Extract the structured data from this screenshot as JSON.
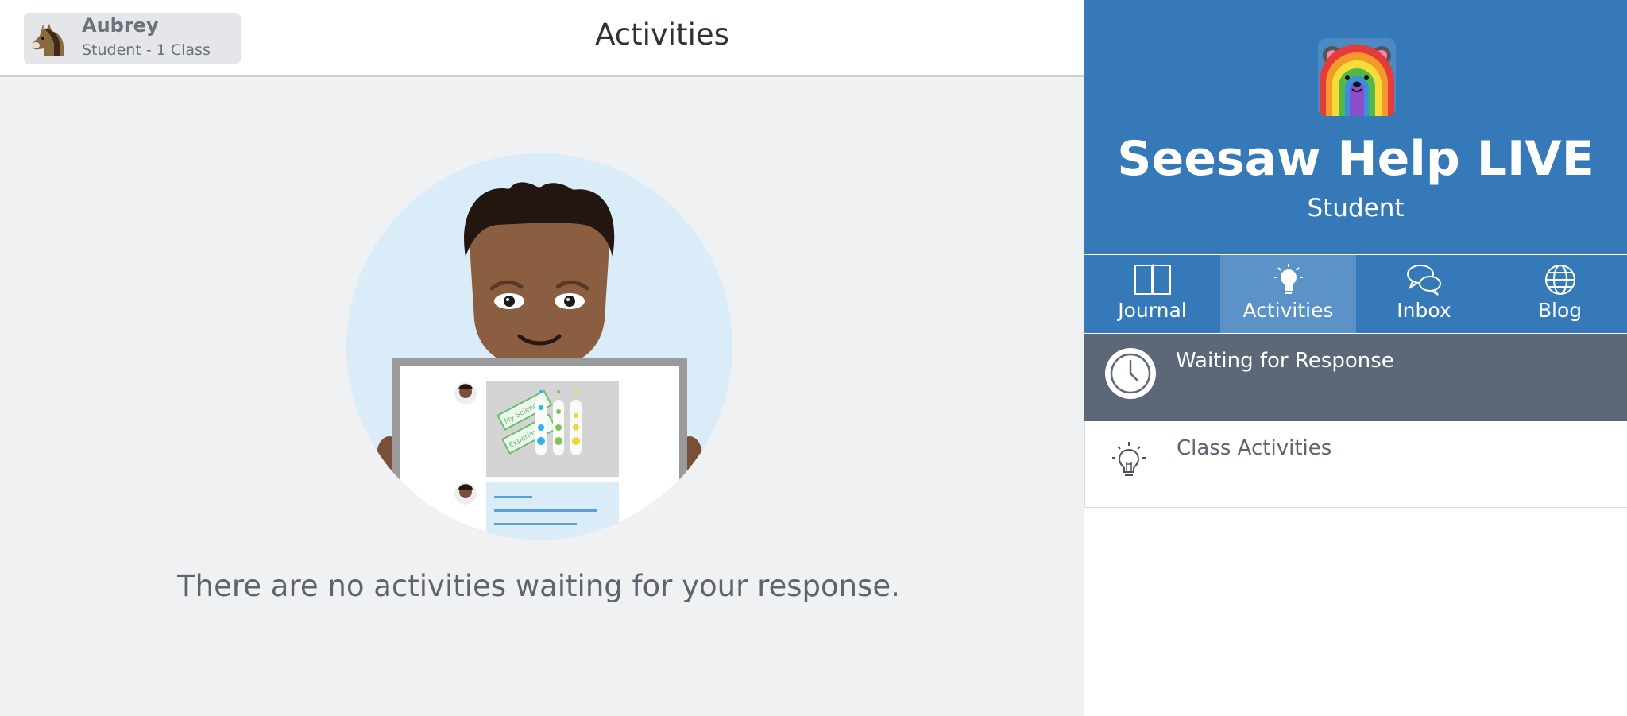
{
  "user": {
    "name": "Aubrey",
    "subtitle": "Student - 1 Class",
    "avatar_icon": "horse-icon"
  },
  "header": {
    "title": "Activities"
  },
  "main": {
    "empty_message": "There are no activities waiting for your response.",
    "illustration": "student-holding-tablet-illustration",
    "illustration_labels": [
      "My Science",
      "Experiment"
    ]
  },
  "class_panel": {
    "icon": "rainbow-bear-icon",
    "name": "Seesaw Help LIVE",
    "role": "Student",
    "tabs": [
      {
        "label": "Journal",
        "icon": "book-icon",
        "active": false
      },
      {
        "label": "Activities",
        "icon": "lightbulb-icon",
        "active": true
      },
      {
        "label": "Inbox",
        "icon": "chat-bubbles-icon",
        "active": false
      },
      {
        "label": "Blog",
        "icon": "globe-icon",
        "active": false
      }
    ],
    "items": [
      {
        "label": "Waiting for Response",
        "icon": "clock-icon",
        "selected": true
      },
      {
        "label": "Class Activities",
        "icon": "lightbulb-icon",
        "selected": false
      }
    ]
  },
  "colors": {
    "brand_blue": "#3579b8",
    "active_tab": "#5b93c8",
    "selected_row": "#5c6878",
    "page_bg": "#f0f1f3"
  }
}
